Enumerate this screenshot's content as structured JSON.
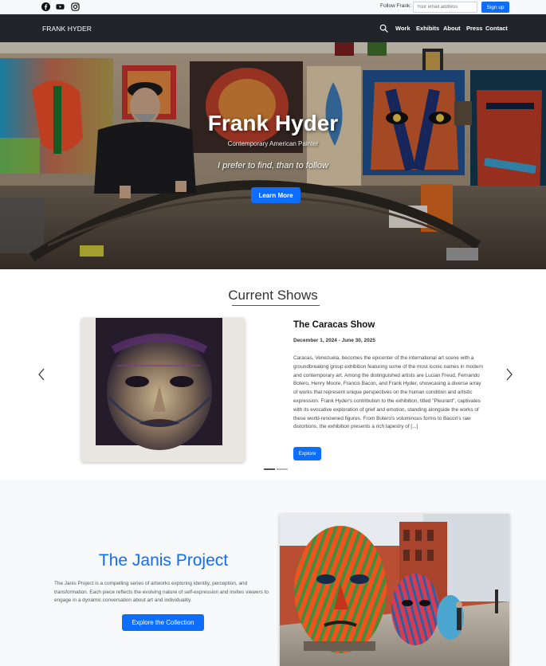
{
  "topbar": {
    "social_icons": [
      "facebook-icon",
      "youtube-icon",
      "instagram-icon"
    ],
    "follow_label": "Follow Frank:",
    "email_placeholder": "Your email address",
    "signup_label": "Sign up"
  },
  "navbar": {
    "brand": "FRANK HYDER",
    "search_icon": "search-icon",
    "links": [
      "Work",
      "Exhibits",
      "About",
      "Press",
      "Contact"
    ]
  },
  "hero": {
    "title": "Frank Hyder",
    "subtitle": "Contemporary American Painter",
    "tagline": "I prefer to find, than to follow",
    "button_label": "Learn More"
  },
  "current_shows": {
    "section_title": "Current Shows",
    "prev_icon": "chevron-left-icon",
    "next_icon": "chevron-right-icon",
    "slide": {
      "title": "The Caracas Show",
      "dates": "December 1, 2024 - June 30, 2025",
      "description": "Caracas, Venezuela, becomes the epicenter of the international art scene with a groundbreaking group exhibition featuring some of the most iconic names in modern and contemporary art. Among the distinguished artists are Lucian Freud, Fernando Botero, Henry Moore, Francis Bacon, and Frank Hyder, showcasing a diverse array of works that represent unique perspectives on the human condition and artistic expression. Frank Hyder's contribution to the exhibition, titled \"Pleurant\", captivates with its evocative exploration of grief and emotion, standing alongside the works of these world-renowned figures. From Botero's voluminous forms to Bacon's raw distortions, the exhibition presents a rich tapestry of [...]",
      "button_label": "Explore"
    },
    "indicator_count": 2,
    "active_indicator": 1
  },
  "janis": {
    "title": "The Janis Project",
    "description": "The Janis Project is a compelling series of artworks exploring identity, perception, and transformation. Each piece reflects the evolving nature of self-expression and invites viewers to engage in a dynamic conversation about art and individuality.",
    "button_label": "Explore the Collection"
  },
  "colors": {
    "accent": "#0d6efd",
    "navbar": "#212529",
    "topbar": "#f8f9fa",
    "section_bg": "#f8f9fa"
  }
}
